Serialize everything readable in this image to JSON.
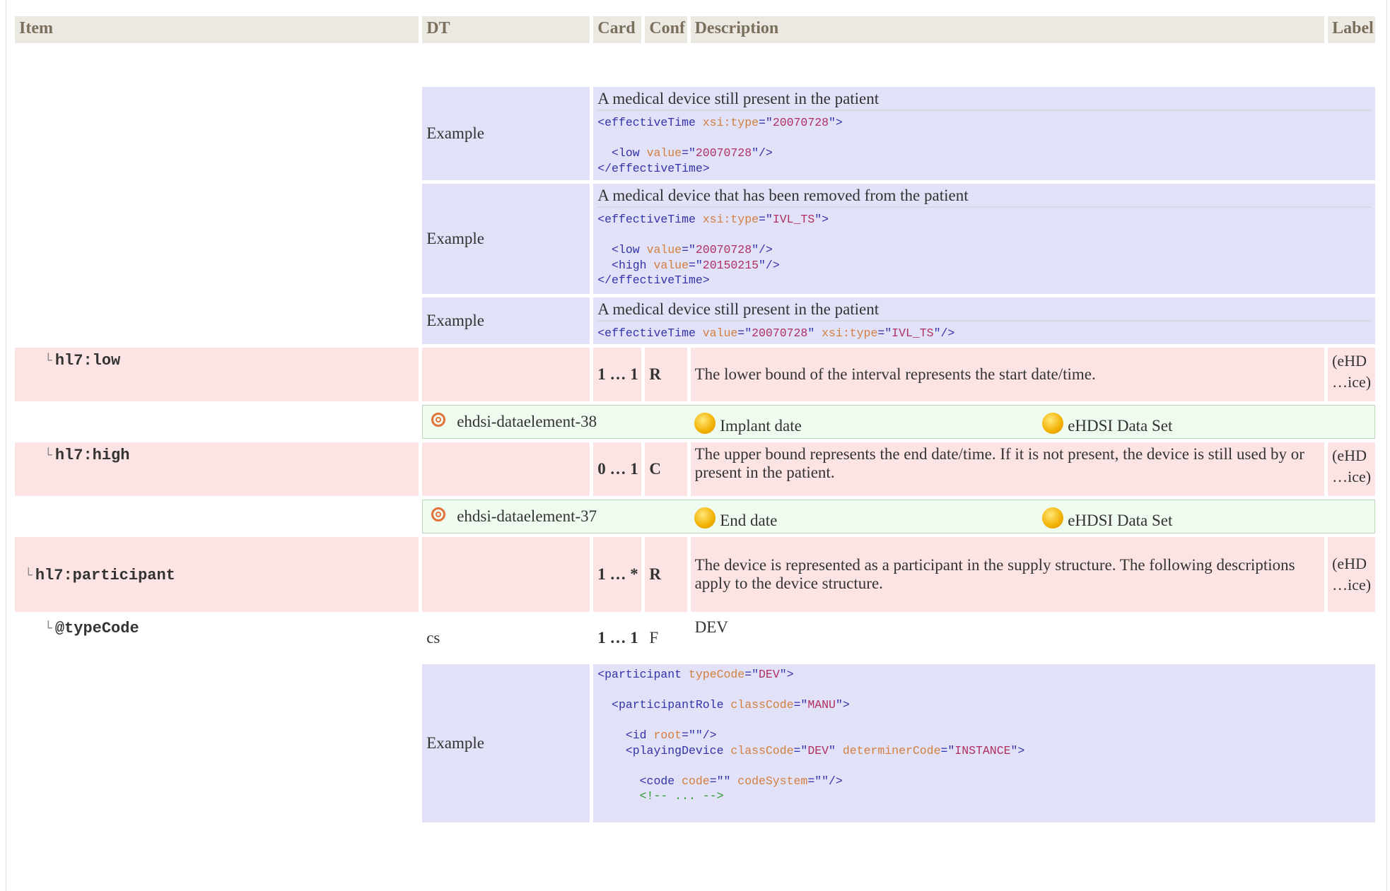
{
  "headers": {
    "item": "Item",
    "dt": "DT",
    "card": "Card",
    "conf": "Conf",
    "description": "Description",
    "label": "Label"
  },
  "examples": [
    {
      "label": "Example",
      "title": "A medical device still present in the patient",
      "code_lines": [
        [
          {
            "t": "<effectiveTime "
          },
          {
            "a": "xsi:type"
          },
          {
            "t": "=\""
          },
          {
            "v": "20070728"
          },
          {
            "t": "\">"
          }
        ],
        [],
        [
          {
            "t": "  <low "
          },
          {
            "a": "value"
          },
          {
            "t": "=\""
          },
          {
            "v": "20070728"
          },
          {
            "t": "\"/>"
          }
        ],
        [
          {
            "t": "</effectiveTime>"
          }
        ]
      ]
    },
    {
      "label": "Example",
      "title": "A medical device that has been removed from the patient",
      "code_lines": [
        [
          {
            "t": "<effectiveTime "
          },
          {
            "a": "xsi:type"
          },
          {
            "t": "=\""
          },
          {
            "v": "IVL_TS"
          },
          {
            "t": "\">"
          }
        ],
        [],
        [
          {
            "t": "  <low "
          },
          {
            "a": "value"
          },
          {
            "t": "=\""
          },
          {
            "v": "20070728"
          },
          {
            "t": "\"/>"
          }
        ],
        [
          {
            "t": "  <high "
          },
          {
            "a": "value"
          },
          {
            "t": "=\""
          },
          {
            "v": "20150215"
          },
          {
            "t": "\"/>"
          }
        ],
        [
          {
            "t": "</effectiveTime>"
          }
        ]
      ]
    },
    {
      "label": "Example",
      "title": "A medical device still present in the patient",
      "code_lines": [
        [
          {
            "t": "<effectiveTime "
          },
          {
            "a": "value"
          },
          {
            "t": "=\""
          },
          {
            "v": "20070728"
          },
          {
            "t": "\" "
          },
          {
            "a": "xsi:type"
          },
          {
            "t": "=\""
          },
          {
            "v": "IVL_TS"
          },
          {
            "t": "\"/>"
          }
        ]
      ]
    }
  ],
  "rows": {
    "low": {
      "name": "hl7:low",
      "card": "1 … 1",
      "conf": "R",
      "description": "The lower bound of the interval represents the start date/time.",
      "label_top": "(eHD",
      "label_bottom": "…ice)",
      "assoc": {
        "id": "ehdsi-dataelement-38",
        "concept": "Implant date",
        "dataset": "eHDSI Data Set"
      }
    },
    "high": {
      "name": "hl7:high",
      "card": "0 … 1",
      "conf": "C",
      "description": "The upper bound represents the end date/time. If it is not present, the device is still used by or present in the patient.",
      "label_top": "(eHD",
      "label_bottom": "…ice)",
      "assoc": {
        "id": "ehdsi-dataelement-37",
        "concept": "End date",
        "dataset": "eHDSI Data Set"
      }
    },
    "participant": {
      "name": "hl7:participant",
      "card": "1 … *",
      "conf": "R",
      "description": "The device is represented as a participant in the supply structure. The following descriptions apply to the device structure.",
      "label_top": "(eHD",
      "label_bottom": "…ice)"
    },
    "typecode": {
      "name": "@typeCode",
      "dt": "cs",
      "card": "1 … 1",
      "conf": "F",
      "description": "DEV"
    }
  },
  "participant_example": {
    "label": "Example",
    "code_lines": [
      [
        {
          "t": "<participant "
        },
        {
          "a": "typeCode"
        },
        {
          "t": "=\""
        },
        {
          "v": "DEV"
        },
        {
          "t": "\">"
        }
      ],
      [],
      [
        {
          "t": "  <participantRole "
        },
        {
          "a": "classCode"
        },
        {
          "t": "=\""
        },
        {
          "v": "MANU"
        },
        {
          "t": "\">"
        }
      ],
      [],
      [
        {
          "t": "    <id "
        },
        {
          "a": "root"
        },
        {
          "t": "=\"\"/>"
        }
      ],
      [
        {
          "t": "    <playingDevice "
        },
        {
          "a": "classCode"
        },
        {
          "t": "=\""
        },
        {
          "v": "DEV"
        },
        {
          "t": "\" "
        },
        {
          "a": "determinerCode"
        },
        {
          "t": "=\""
        },
        {
          "v": "INSTANCE"
        },
        {
          "t": "\">"
        }
      ],
      [],
      [
        {
          "t": "      <code "
        },
        {
          "a": "code"
        },
        {
          "t": "=\"\" "
        },
        {
          "a": "codeSystem"
        },
        {
          "t": "=\"\"/>"
        }
      ],
      [
        {
          "c": "      <!-- ... -->"
        }
      ]
    ]
  },
  "icons": {
    "tree": "tree-branch-icon",
    "target": "target-icon",
    "concept": "concept-dot-icon"
  }
}
